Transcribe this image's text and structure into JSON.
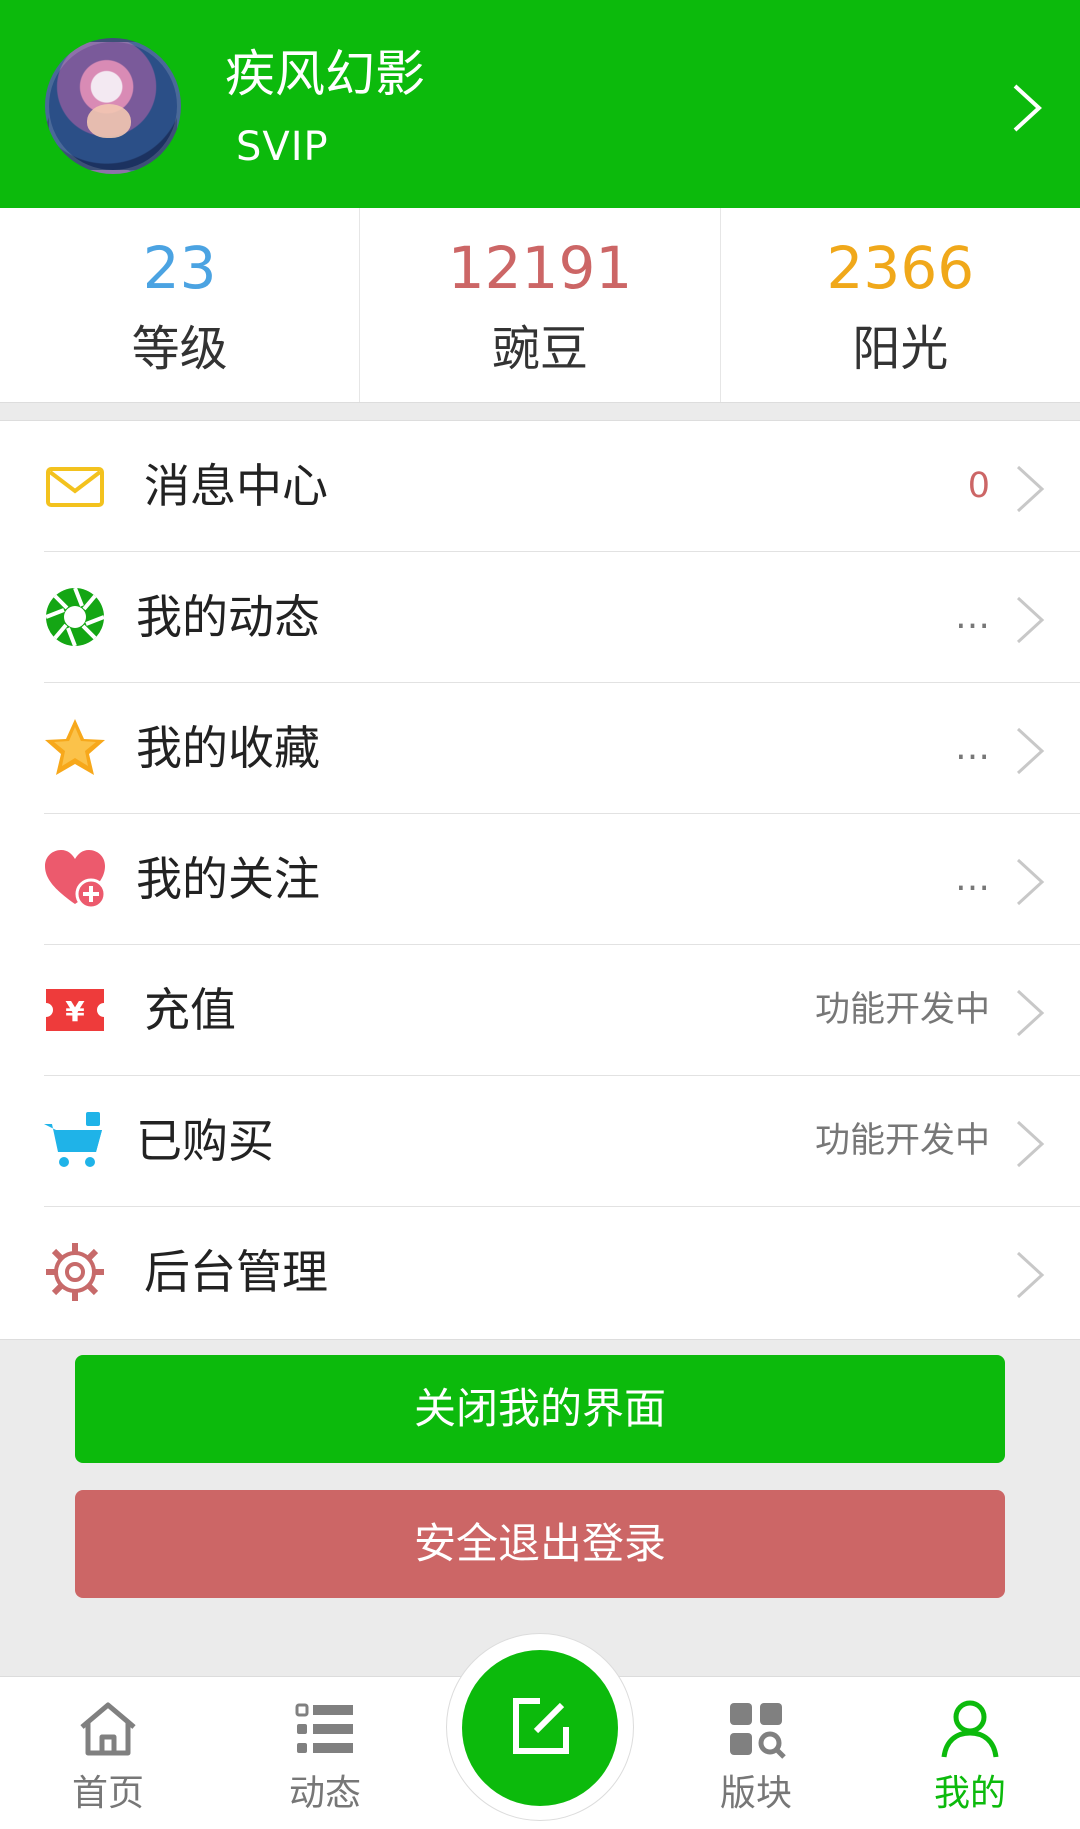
{
  "profile": {
    "username": "疾风幻影",
    "level_badge": "SVIP"
  },
  "stats": [
    {
      "value": "23",
      "label": "等级",
      "color": "#4ba3e2"
    },
    {
      "value": "12191",
      "label": "豌豆",
      "color": "#cc6666"
    },
    {
      "value": "2366",
      "label": "阳光",
      "color": "#f0a81a"
    }
  ],
  "menu": {
    "items": [
      {
        "label": "消息中心",
        "value": "0",
        "icon": "envelope-icon"
      },
      {
        "label": "我的动态",
        "value": "…",
        "icon": "aperture-icon"
      },
      {
        "label": "我的收藏",
        "value": "…",
        "icon": "star-icon"
      },
      {
        "label": "我的关注",
        "value": "…",
        "icon": "heart-plus-icon"
      },
      {
        "label": "充值",
        "value": "功能开发中",
        "icon": "yen-ticket-icon"
      },
      {
        "label": "已购买",
        "value": "功能开发中",
        "icon": "cart-icon"
      },
      {
        "label": "后台管理",
        "value": "",
        "icon": "gear-icon"
      }
    ]
  },
  "buttons": {
    "close_label": "关闭我的界面",
    "logout_label": "安全退出登录"
  },
  "tabbar": {
    "tabs": [
      {
        "label": "首页",
        "icon": "home-icon"
      },
      {
        "label": "动态",
        "icon": "list-icon"
      },
      {
        "label": "版块",
        "icon": "grid-search-icon"
      },
      {
        "label": "我的",
        "icon": "user-icon"
      }
    ],
    "compose_icon": "edit-icon",
    "active_tab": "我的"
  },
  "colors": {
    "brand_green": "#0cba0c",
    "logout_red": "#cc6666",
    "message_count": "#cc6666"
  }
}
